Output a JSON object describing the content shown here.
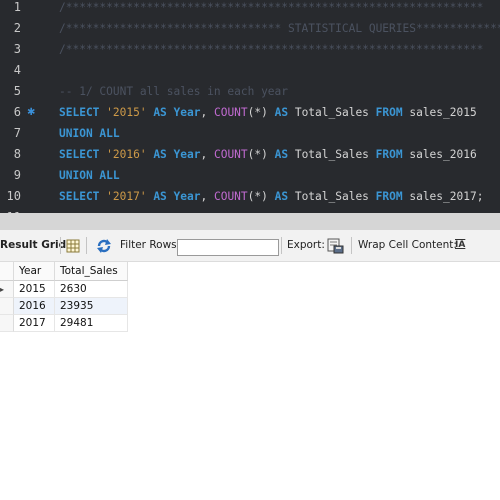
{
  "editor": {
    "lines": [
      {
        "num": "1",
        "segs": [
          {
            "t": "/**************************************************************",
            "c": "cm"
          }
        ]
      },
      {
        "num": "2",
        "segs": [
          {
            "t": "/******************************** STATISTICAL QUERIES******************",
            "c": "cm"
          }
        ]
      },
      {
        "num": "3",
        "segs": [
          {
            "t": "/**************************************************************",
            "c": "cm"
          }
        ]
      },
      {
        "num": "4",
        "segs": []
      },
      {
        "num": "5",
        "segs": [
          {
            "t": "-- 1/ COUNT all sales in each year",
            "c": "cm"
          }
        ]
      },
      {
        "num": "6",
        "marker": true,
        "segs": [
          {
            "t": "SELECT ",
            "c": "kw"
          },
          {
            "t": "'2015'",
            "c": "str"
          },
          {
            "t": " AS ",
            "c": "kw"
          },
          {
            "t": "Year",
            "c": "kw"
          },
          {
            "t": ", ",
            "c": "pl"
          },
          {
            "t": "COUNT",
            "c": "fn"
          },
          {
            "t": "(*)",
            "c": "pl"
          },
          {
            "t": " AS ",
            "c": "kw"
          },
          {
            "t": "Total_Sales",
            "c": "pl"
          },
          {
            "t": " FROM ",
            "c": "kw"
          },
          {
            "t": "sales_2015",
            "c": "pl"
          }
        ]
      },
      {
        "num": "7",
        "segs": [
          {
            "t": "UNION ALL",
            "c": "kw"
          }
        ]
      },
      {
        "num": "8",
        "segs": [
          {
            "t": "SELECT ",
            "c": "kw"
          },
          {
            "t": "'2016'",
            "c": "str"
          },
          {
            "t": " AS ",
            "c": "kw"
          },
          {
            "t": "Year",
            "c": "kw"
          },
          {
            "t": ", ",
            "c": "pl"
          },
          {
            "t": "COUNT",
            "c": "fn"
          },
          {
            "t": "(*)",
            "c": "pl"
          },
          {
            "t": " AS ",
            "c": "kw"
          },
          {
            "t": "Total_Sales",
            "c": "pl"
          },
          {
            "t": " FROM ",
            "c": "kw"
          },
          {
            "t": "sales_2016",
            "c": "pl"
          }
        ]
      },
      {
        "num": "9",
        "segs": [
          {
            "t": "UNION ALL",
            "c": "kw"
          }
        ]
      },
      {
        "num": "10",
        "segs": [
          {
            "t": "SELECT ",
            "c": "kw"
          },
          {
            "t": "'2017'",
            "c": "str"
          },
          {
            "t": " AS ",
            "c": "kw"
          },
          {
            "t": "Year",
            "c": "kw"
          },
          {
            "t": ", ",
            "c": "pl"
          },
          {
            "t": "COUNT",
            "c": "fn"
          },
          {
            "t": "(*)",
            "c": "pl"
          },
          {
            "t": " AS ",
            "c": "kw"
          },
          {
            "t": "Total_Sales",
            "c": "pl"
          },
          {
            "t": " FROM ",
            "c": "kw"
          },
          {
            "t": "sales_2017;",
            "c": "pl"
          }
        ]
      },
      {
        "num": "11",
        "segs": []
      }
    ]
  },
  "toolbar": {
    "result_grid_label": "Result Grid",
    "filter_rows_label": "Filter Rows:",
    "filter_rows_value": "",
    "export_label": "Export:",
    "wrap_label": "Wrap Cell Content:",
    "wrap_icon_text": "IA"
  },
  "grid": {
    "columns": [
      "Year",
      "Total_Sales"
    ],
    "rows": [
      {
        "year": "2015",
        "total": "2630",
        "current": true
      },
      {
        "year": "2016",
        "total": "23935"
      },
      {
        "year": "2017",
        "total": "29481"
      }
    ],
    "current_row_marker": "▸"
  },
  "colors": {
    "editor_bg": "#282a2e",
    "keyword": "#3b96d4",
    "string": "#ce9a48",
    "function": "#c06ad0",
    "comment": "#4b5260",
    "alt_row": "#eef3fb"
  }
}
